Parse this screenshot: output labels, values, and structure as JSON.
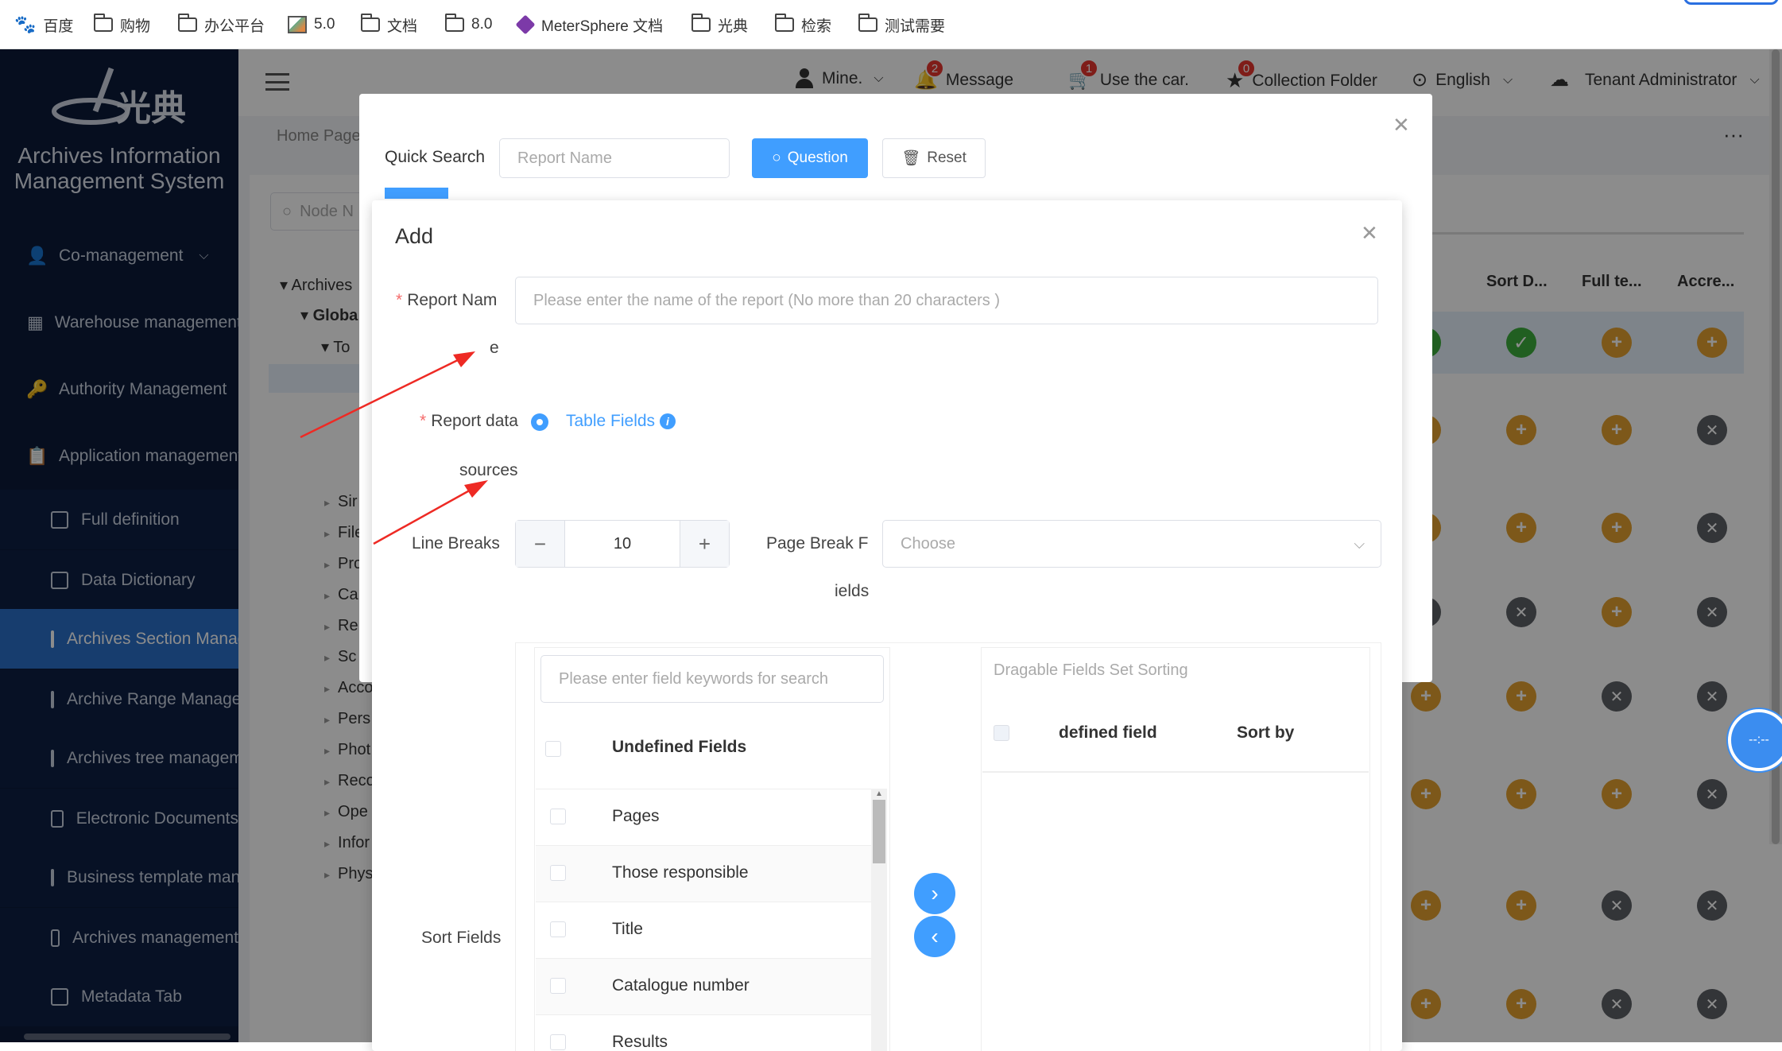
{
  "bookmarks": [
    {
      "label": "百度",
      "icon": "baidu-icon"
    },
    {
      "label": "购物",
      "icon": "folder-icon"
    },
    {
      "label": "办公平台",
      "icon": "folder-icon"
    },
    {
      "label": "5.0",
      "icon": "image-icon"
    },
    {
      "label": "文档",
      "icon": "folder-icon"
    },
    {
      "label": "8.0",
      "icon": "folder-icon"
    },
    {
      "label": "MeterSphere 文档",
      "icon": "metersphere-icon"
    },
    {
      "label": "光典",
      "icon": "folder-icon"
    },
    {
      "label": "检索",
      "icon": "folder-icon"
    },
    {
      "label": "测试需要",
      "icon": "folder-icon"
    }
  ],
  "brand": {
    "logo_text": "光典",
    "system_name_line1": "Archives Information",
    "system_name_line2": "Management System"
  },
  "sidebar": {
    "items": [
      {
        "label": "Co-management",
        "icon": "users-icon"
      },
      {
        "label": "Warehouse management",
        "icon": "building-icon"
      },
      {
        "label": "Authority Management",
        "icon": "key-icon"
      },
      {
        "label": "Application management",
        "icon": "clipboard-icon"
      }
    ],
    "subitems": [
      {
        "label": "Full definition",
        "icon": "document-icon"
      },
      {
        "label": "Data Dictionary",
        "icon": "book-icon"
      },
      {
        "label": "Archives Section Management",
        "icon": "chart-icon",
        "active": true
      },
      {
        "label": "Archive Range Management",
        "icon": "file-icon"
      },
      {
        "label": "Archives tree management",
        "icon": "tree-icon"
      },
      {
        "label": "Electronic Documents",
        "icon": "building-icon"
      },
      {
        "label": "Business template management",
        "icon": "template-icon"
      },
      {
        "label": "Archives management",
        "icon": "bar-chart-icon"
      },
      {
        "label": "Metadata Tab",
        "icon": "tag-icon"
      }
    ]
  },
  "topbar": {
    "user": "Mine.",
    "message": "Message",
    "message_count": "2",
    "cart": "Use the car.",
    "cart_count": "1",
    "collection": "Collection Folder",
    "collection_count": "0",
    "language": "English",
    "tenant": "Tenant Administrator"
  },
  "breadcrumb": "Home Page",
  "tree": {
    "search_placeholder": "Node N",
    "root": "Archives",
    "global": "Globa",
    "to": "To",
    "nodes": [
      "Sir",
      "File",
      "Pro",
      "Ca",
      "Re",
      "Sc",
      "Acco",
      "Pers",
      "Phot",
      "Reco",
      "Ope",
      "Infor",
      "Phys"
    ]
  },
  "table_headers": [
    "...",
    "Sort D...",
    "Full te...",
    "Accre..."
  ],
  "search_dialog": {
    "quick_search": "Quick Search",
    "report_placeholder": "Report Name",
    "question": "Question",
    "reset": "Reset"
  },
  "add_dialog": {
    "title": "Add",
    "report_name_label": "Report Nam",
    "report_name_label_wrap": "e",
    "report_name_placeholder": "Please enter the name of the report (No more than 20 characters )",
    "report_data_label": "Report data",
    "report_data_label_wrap": "sources",
    "table_fields": "Table Fields",
    "line_breaks_label": "Line Breaks",
    "line_breaks_value": "10",
    "page_break_label": "Page Break F",
    "page_break_label_wrap": "ields",
    "page_break_placeholder": "Choose",
    "sort_fields_label": "Sort Fields",
    "field_search_placeholder": "Please enter field keywords for search",
    "undefined_fields_header": "Undefined Fields",
    "undefined_fields": [
      "Pages",
      "Those responsible",
      "Title",
      "Catalogue number",
      "Results"
    ],
    "drag_title": "Dragable Fields Set Sorting",
    "defined_field_header": "defined field",
    "sort_by_header": "Sort by"
  },
  "colors": {
    "sidebar_bg": "#0b1a39",
    "accent": "#409eff",
    "active_item": "#2a6fc9",
    "plus": "#e3a130",
    "cross": "#5e6166",
    "check": "#3cae3c",
    "arrow": "#ee2a24"
  }
}
